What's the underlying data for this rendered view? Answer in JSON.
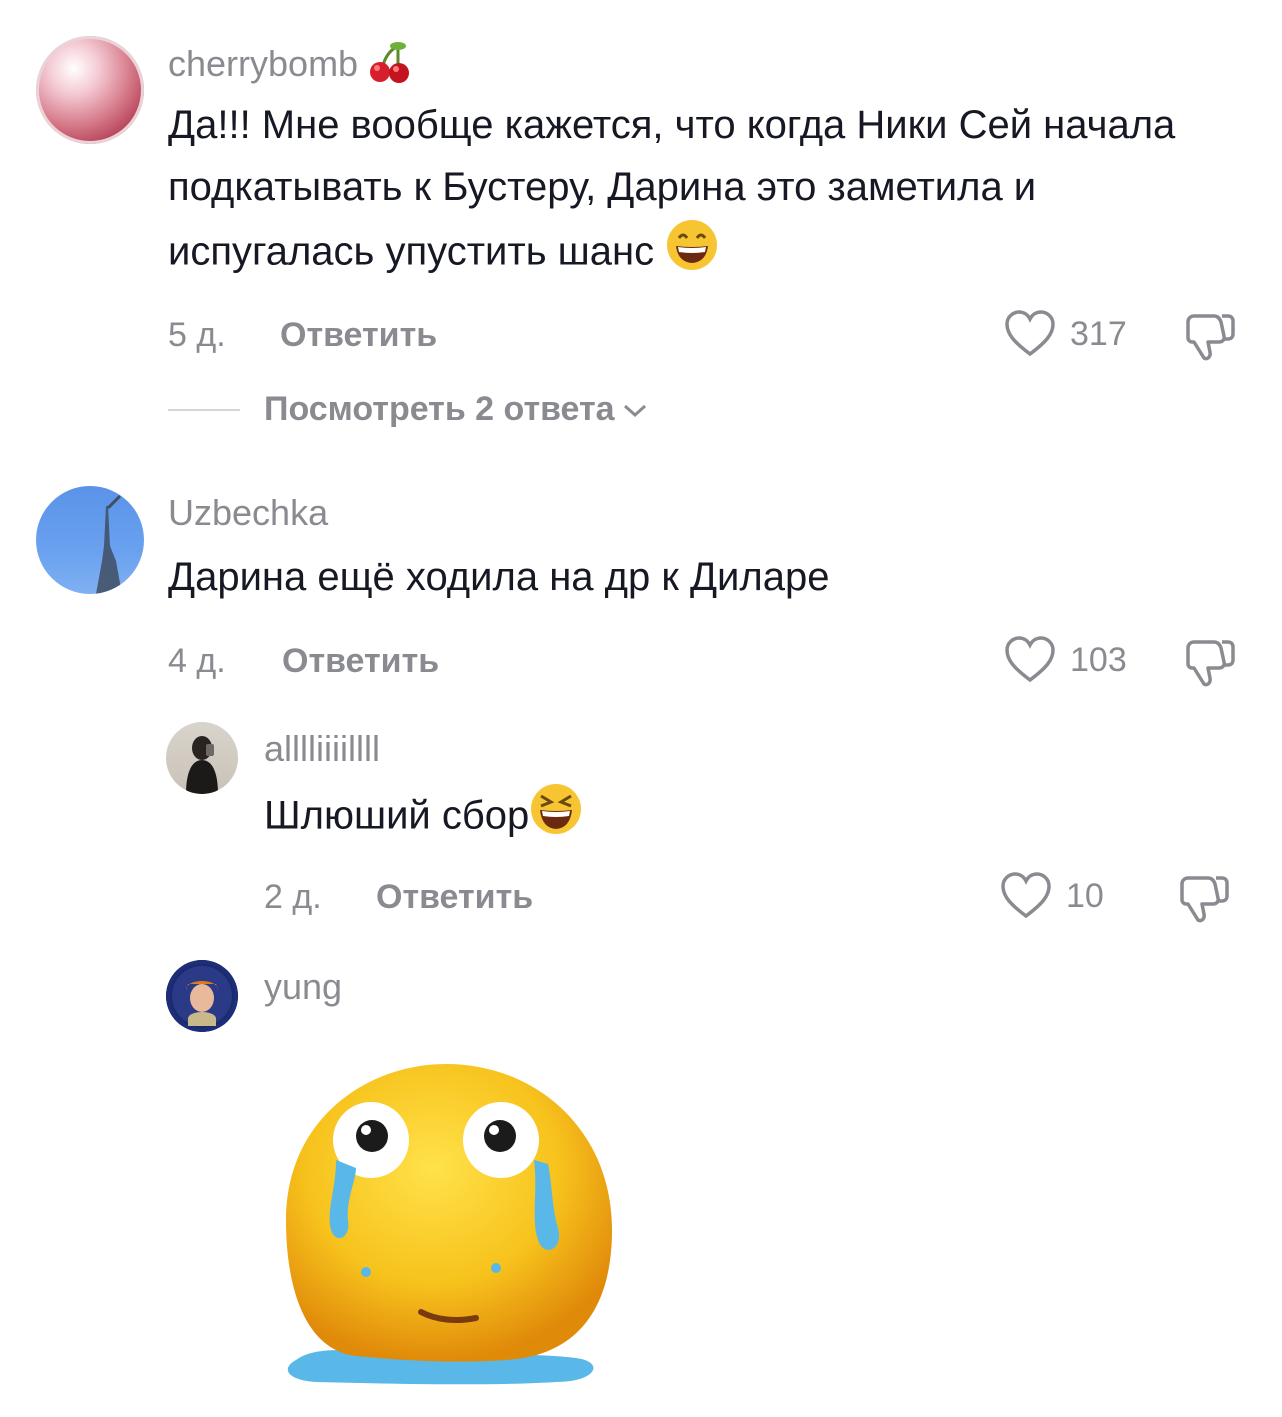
{
  "comments": [
    {
      "username": "cherrybomb",
      "username_emoji": "cherries-icon",
      "text": "Да!!! Мне вообще кажется, что когда Ники Сей начала подкатывать к Бустеру, Дарина это заметила и испугалась упустить шанс",
      "text_emoji": "grinning-face-icon",
      "age": "5 д.",
      "reply_label": "Ответить",
      "likes": "317",
      "view_replies": "Посмотреть 2 ответа"
    },
    {
      "username": "Uzbechka",
      "text": "Дарина ещё ходила на др к Диларе",
      "age": "4 д.",
      "reply_label": "Ответить",
      "likes": "103"
    },
    {
      "username": "alllliiiillll",
      "text": "Шлюший сбор",
      "text_emoji": "laughing-squinting-face-icon",
      "age": "2 д.",
      "reply_label": "Ответить",
      "likes": "10"
    },
    {
      "username": "yung",
      "sticker": "crying-melting-face-sticker"
    }
  ],
  "colors": {
    "text": "#161823",
    "muted": "#8a8b91"
  }
}
